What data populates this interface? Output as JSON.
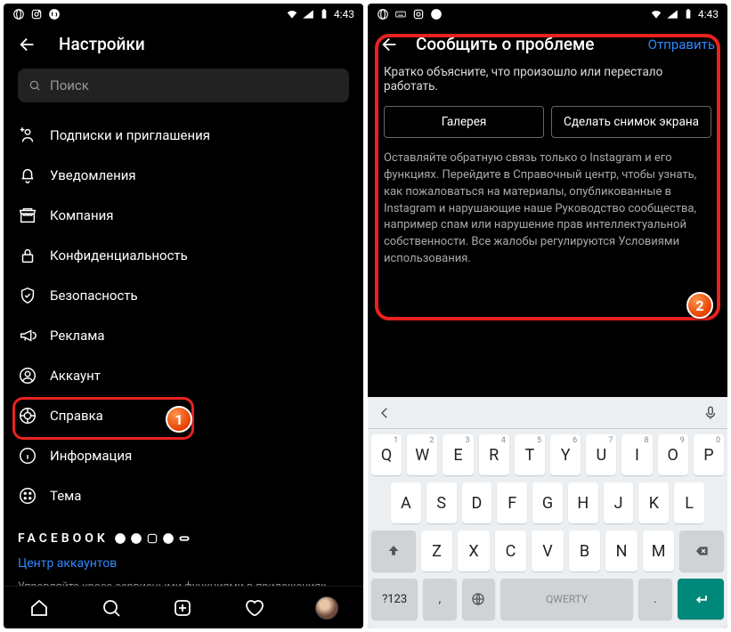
{
  "statusbar": {
    "time": "4:43"
  },
  "left": {
    "title": "Настройки",
    "search_placeholder": "Поиск",
    "items": [
      {
        "label": "Подписки и приглашения",
        "icon": "user-plus-icon"
      },
      {
        "label": "Уведомления",
        "icon": "bell-icon"
      },
      {
        "label": "Компания",
        "icon": "storefront-icon"
      },
      {
        "label": "Конфиденциальность",
        "icon": "lock-icon"
      },
      {
        "label": "Безопасность",
        "icon": "shield-icon"
      },
      {
        "label": "Реклама",
        "icon": "megaphone-icon"
      },
      {
        "label": "Аккаунт",
        "icon": "account-icon"
      },
      {
        "label": "Справка",
        "icon": "help-icon"
      },
      {
        "label": "Информация",
        "icon": "info-icon"
      },
      {
        "label": "Тема",
        "icon": "theme-icon"
      }
    ],
    "facebook_label": "FACEBOOK",
    "account_center": "Центр аккаунтов",
    "account_center_desc": "Управляйте кросс-сервисными функциями в приложениях Instagram, Facebook и Messenger, например входом в аккаунт"
  },
  "right": {
    "title": "Сообщить о проблеме",
    "send": "Отправить",
    "prompt": "Кратко объясните, что произошло или перестало работать.",
    "btn_gallery": "Галерея",
    "btn_screenshot": "Сделать снимок экрана",
    "fineprint": "Оставляйте обратную связь только о Instagram и его функциях. Перейдите в Справочный центр, чтобы узнать, как пожаловаться на материалы, опубликованные в Instagram и нарушающие наше Руководство сообщества, например спам или нарушение прав интеллектуальной собственности. Все жалобы регулируются Условиями использования."
  },
  "keyboard": {
    "r1": [
      "Q",
      "W",
      "E",
      "R",
      "T",
      "Y",
      "U",
      "I",
      "O",
      "P"
    ],
    "r1sup": [
      "1",
      "2",
      "3",
      "4",
      "5",
      "6",
      "7",
      "8",
      "9",
      "0"
    ],
    "r2": [
      "A",
      "S",
      "D",
      "F",
      "G",
      "H",
      "J",
      "K",
      "L"
    ],
    "r3": [
      "Z",
      "X",
      "C",
      "V",
      "B",
      "N",
      "M"
    ],
    "mode": "?123",
    "space": "QWERTY"
  },
  "badges": {
    "one": "1",
    "two": "2"
  }
}
